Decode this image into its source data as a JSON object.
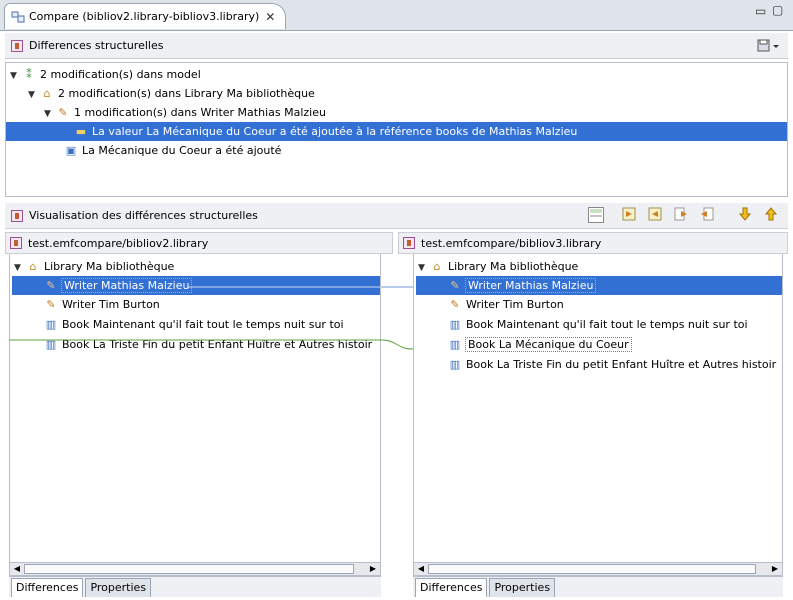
{
  "editor": {
    "tab_title": "Compare (bibliov2.library-bibliov3.library)",
    "close_glyph": "✕",
    "minimize_glyph": "▭",
    "maximize_glyph": "▢"
  },
  "structural": {
    "title": "Differences structurelles",
    "rows": [
      {
        "label": "2 modification(s) dans   model"
      },
      {
        "label": "2 modification(s) dans Library Ma bibliothèque"
      },
      {
        "label": "1 modification(s) dans Writer Mathias Malzieu"
      },
      {
        "label": "La valeur La Mécanique du Coeur a été ajoutée à la référence books de Mathias Malzieu"
      },
      {
        "label": "La Mécanique du Coeur a été ajouté"
      }
    ]
  },
  "visualisation": {
    "title": "Visualisation des différences structurelles"
  },
  "left_pane": {
    "path": "test.emfcompare/bibliov2.library",
    "rows": [
      {
        "label": "Library Ma bibliothèque"
      },
      {
        "label": "Writer Mathias Malzieu"
      },
      {
        "label": "Writer Tim Burton"
      },
      {
        "label": "Book Maintenant qu'il fait tout le temps nuit sur toi"
      },
      {
        "label": "Book La Triste Fin du petit Enfant Huître et Autres histoir"
      }
    ],
    "tabs": [
      "Differences",
      "Properties"
    ]
  },
  "right_pane": {
    "path": "test.emfcompare/bibliov3.library",
    "rows": [
      {
        "label": "Library Ma bibliothèque"
      },
      {
        "label": "Writer Mathias Malzieu"
      },
      {
        "label": "Writer Tim Burton"
      },
      {
        "label": "Book Maintenant qu'il fait tout le temps nuit sur toi"
      },
      {
        "label": "Book La Mécanique du Coeur"
      },
      {
        "label": "Book La Triste Fin du petit Enfant Huître et Autres histoir"
      }
    ],
    "tabs": [
      "Differences",
      "Properties"
    ]
  },
  "colors": {
    "selection": "#3370d4",
    "connector_blue": "#6f9ad8",
    "connector_green": "#5aa040"
  }
}
